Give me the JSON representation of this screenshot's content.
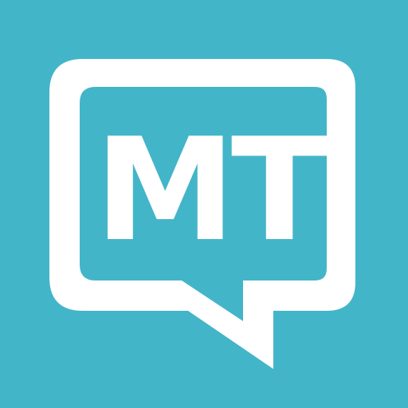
{
  "icon": {
    "name": "speech-bubble-icon",
    "logo_text": "MT",
    "background_color": "#43b5c9",
    "foreground_color": "#ffffff"
  }
}
